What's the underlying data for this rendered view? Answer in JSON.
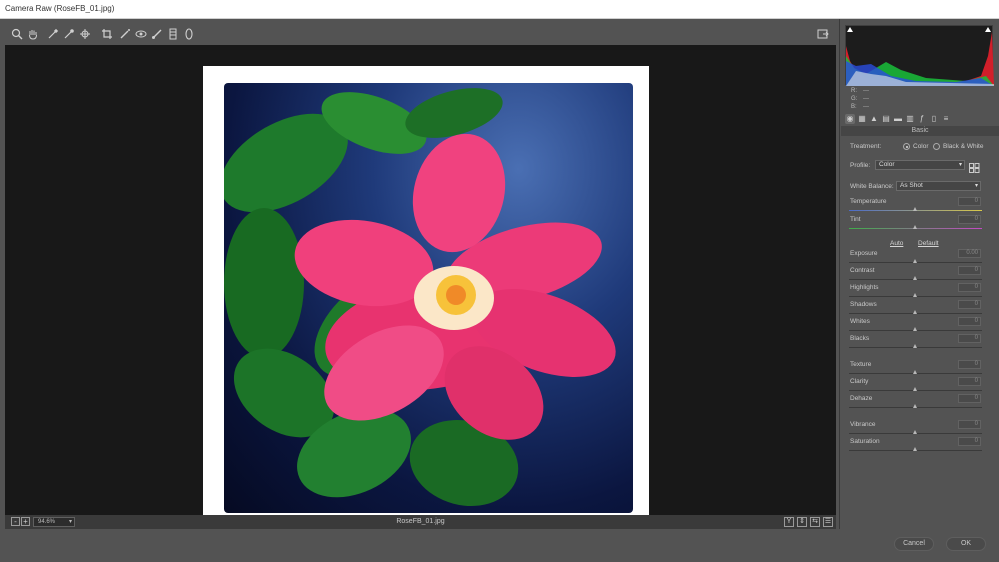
{
  "window": {
    "title": "Camera Raw (RoseFB_01.jpg)"
  },
  "toolbar": {
    "tools": [
      "zoom-icon",
      "hand-icon",
      "white-balance-icon",
      "color-sampler-icon",
      "targeted-adjustment-icon",
      "crop-icon",
      "spot-removal-icon",
      "red-eye-icon",
      "adjustment-brush-icon",
      "graduated-filter-icon",
      "radial-filter-icon"
    ]
  },
  "status": {
    "zoom": "94.6%",
    "filename": "RoseFB_01.jpg",
    "view_buttons": [
      "Y",
      "",
      "",
      ""
    ]
  },
  "rgb": {
    "r_label": "R:",
    "r_value": "---",
    "g_label": "G:",
    "g_value": "---",
    "b_label": "B:",
    "b_value": "---"
  },
  "panel": {
    "title": "Basic",
    "treatment_label": "Treatment:",
    "treatment_color": "Color",
    "treatment_bw": "Black & White",
    "profile_label": "Profile:",
    "profile_value": "Color",
    "wb_label": "White Balance:",
    "wb_value": "As Shot",
    "auto_label": "Auto",
    "default_label": "Default",
    "sliders": [
      {
        "label": "Temperature",
        "value": "0"
      },
      {
        "label": "Tint",
        "value": "0"
      },
      {
        "label": "Exposure",
        "value": "0.00"
      },
      {
        "label": "Contrast",
        "value": "0"
      },
      {
        "label": "Highlights",
        "value": "0"
      },
      {
        "label": "Shadows",
        "value": "0"
      },
      {
        "label": "Whites",
        "value": "0"
      },
      {
        "label": "Blacks",
        "value": "0"
      },
      {
        "label": "Texture",
        "value": "0"
      },
      {
        "label": "Clarity",
        "value": "0"
      },
      {
        "label": "Dehaze",
        "value": "0"
      },
      {
        "label": "Vibrance",
        "value": "0"
      },
      {
        "label": "Saturation",
        "value": "0"
      }
    ]
  },
  "footer": {
    "cancel": "Cancel",
    "ok": "OK"
  }
}
